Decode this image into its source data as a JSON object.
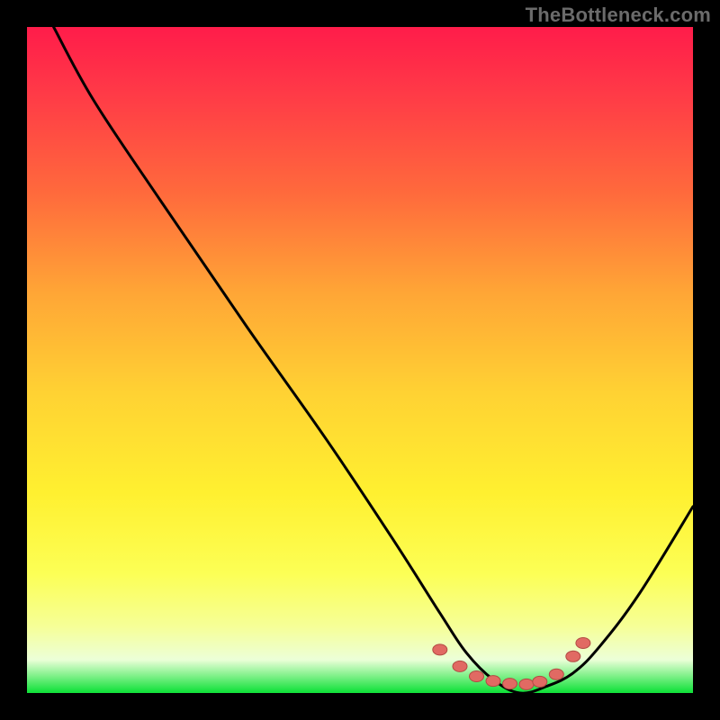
{
  "watermark": "TheBottleneck.com",
  "colors": {
    "page_bg": "#000000",
    "watermark": "#6b6b6b",
    "curve": "#000000",
    "marker_fill": "#e16a63",
    "marker_stroke": "#b24a43",
    "gradient_stops": [
      {
        "offset": 0.0,
        "color": "#ff1c4a"
      },
      {
        "offset": 0.1,
        "color": "#ff3a47"
      },
      {
        "offset": 0.25,
        "color": "#ff6a3c"
      },
      {
        "offset": 0.4,
        "color": "#ffa636"
      },
      {
        "offset": 0.55,
        "color": "#ffd233"
      },
      {
        "offset": 0.7,
        "color": "#fff030"
      },
      {
        "offset": 0.82,
        "color": "#fcff55"
      },
      {
        "offset": 0.9,
        "color": "#f6ff97"
      },
      {
        "offset": 0.95,
        "color": "#ecffd8"
      },
      {
        "offset": 0.998,
        "color": "#14e23c"
      },
      {
        "offset": 1.0,
        "color": "#14e23c"
      }
    ]
  },
  "chart_data": {
    "type": "line",
    "title": "",
    "xlabel": "",
    "ylabel": "",
    "xlim": [
      0,
      100
    ],
    "ylim": [
      0,
      100
    ],
    "series": [
      {
        "name": "bottleneck-curve",
        "x": [
          4,
          10,
          20,
          33,
          45,
          55,
          62,
          66,
          70,
          74,
          78,
          82,
          86,
          92,
          100
        ],
        "y": [
          100,
          89,
          74,
          55,
          38,
          23,
          12,
          6,
          2,
          0,
          1,
          3,
          7,
          15,
          28
        ]
      }
    ],
    "markers": [
      {
        "x": 62.0,
        "y": 6.5
      },
      {
        "x": 65.0,
        "y": 4.0
      },
      {
        "x": 67.5,
        "y": 2.5
      },
      {
        "x": 70.0,
        "y": 1.8
      },
      {
        "x": 72.5,
        "y": 1.4
      },
      {
        "x": 75.0,
        "y": 1.3
      },
      {
        "x": 77.0,
        "y": 1.7
      },
      {
        "x": 79.5,
        "y": 2.8
      },
      {
        "x": 82.0,
        "y": 5.5
      },
      {
        "x": 83.5,
        "y": 7.5
      }
    ]
  }
}
